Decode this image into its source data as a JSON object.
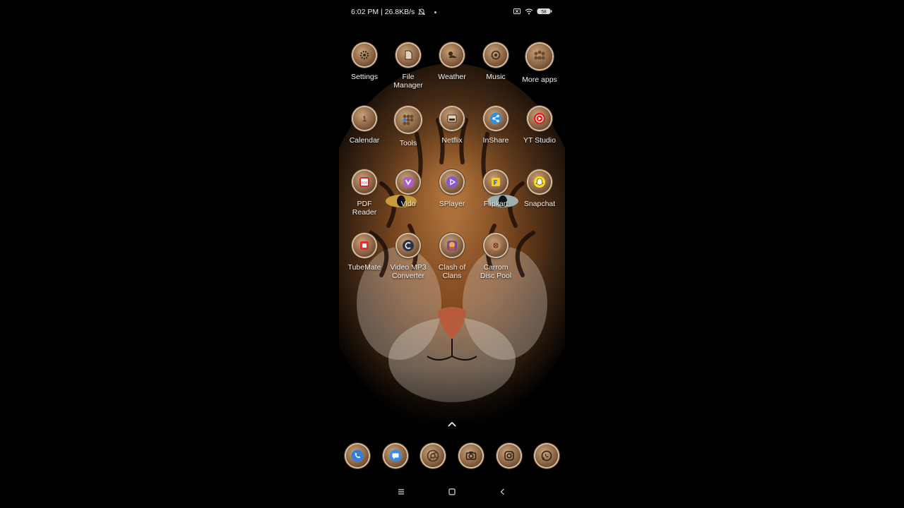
{
  "status_bar": {
    "time_speed": "6:02 PM | 26.8KB/s",
    "battery_level": "58"
  },
  "apps": {
    "row1": [
      {
        "label": "Settings",
        "icon": "gear-icon"
      },
      {
        "label": "File\nManager",
        "icon": "file-icon"
      },
      {
        "label": "Weather",
        "icon": "weather-icon"
      },
      {
        "label": "Music",
        "icon": "music-icon"
      },
      {
        "label": "More apps",
        "icon": "folder-icon"
      }
    ],
    "row2": [
      {
        "label": "Calendar",
        "icon": "calendar-icon"
      },
      {
        "label": "Tools",
        "icon": "folder-icon"
      },
      {
        "label": "Netflix",
        "icon": "netflix-icon"
      },
      {
        "label": "InShare",
        "icon": "share-icon"
      },
      {
        "label": "YT Studio",
        "icon": "yt-studio-icon"
      }
    ],
    "row3": [
      {
        "label": "PDF\nReader",
        "icon": "pdf-icon"
      },
      {
        "label": "Vido",
        "icon": "vido-icon"
      },
      {
        "label": "SPlayer",
        "icon": "play-icon"
      },
      {
        "label": "Flipkart",
        "icon": "flipkart-icon"
      },
      {
        "label": "Snapchat",
        "icon": "snapchat-icon"
      }
    ],
    "row4": [
      {
        "label": "TubeMate",
        "icon": "tubemate-icon"
      },
      {
        "label": "Video MP3\nConverter",
        "icon": "converter-icon"
      },
      {
        "label": "Clash of\nClans",
        "icon": "clash-icon"
      },
      {
        "label": "Carrom\nDisc Pool",
        "icon": "carrom-icon"
      }
    ]
  },
  "dock": [
    "phone-icon",
    "messages-icon",
    "chrome-icon",
    "camera-icon",
    "instagram-icon",
    "whatsapp-icon"
  ],
  "colors": {
    "icon_rim": "#d8c0a0",
    "icon_body": "#8a6444",
    "label_text": "#f2f2f2"
  }
}
